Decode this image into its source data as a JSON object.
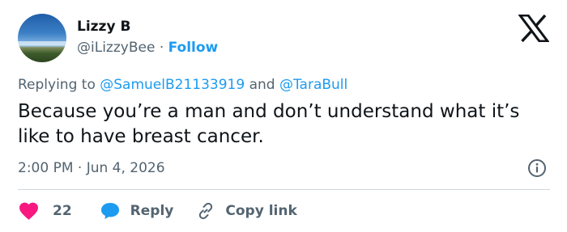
{
  "author": {
    "name": "Lizzy B",
    "handle": "@iLizzyBee",
    "separator": "·",
    "follow_label": "Follow"
  },
  "reply_context": {
    "prefix": "Replying to",
    "mention_1": "@SamuelB21133919",
    "conjunction": "and",
    "mention_2": "@TaraBull"
  },
  "tweet": {
    "text": "Because you’re a man and don’t understand what it’s like to have breast cancer.",
    "timestamp": "2:00 PM · Jun 4, 2026"
  },
  "actions": {
    "like_count": "22",
    "reply_label": "Reply",
    "copy_label": "Copy link"
  },
  "icons": {
    "like": "heart-icon",
    "reply": "speech-bubble-icon",
    "copy": "link-icon",
    "info": "info-icon",
    "brand": "x-logo-icon"
  },
  "colors": {
    "accent": "#1d9bf0",
    "like": "#f91880",
    "secondary_text": "#536471",
    "divider": "#cfd9de"
  }
}
